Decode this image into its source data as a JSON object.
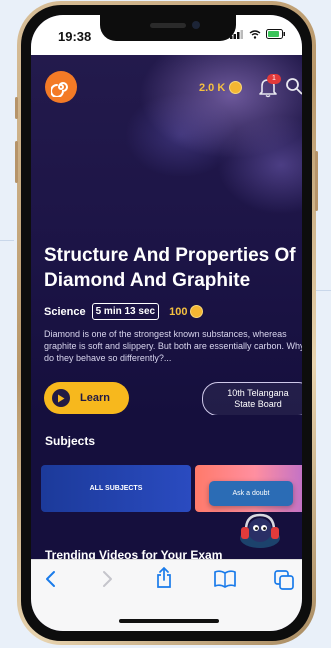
{
  "status": {
    "time": "19:38"
  },
  "header": {
    "coins": "2.0 K",
    "notification_count": "1"
  },
  "video": {
    "title": "Structure And Properties Of Diamond And Graphite",
    "subject": "Science",
    "duration": "5 min 13 sec",
    "points": "100",
    "description": "Diamond is one of the strongest known substances, whereas graphite is soft and slippery. But both are essentially carbon. Why do they behave so differently?..."
  },
  "actions": {
    "learn_label": "Learn",
    "board_label": "10th Telangana State Board"
  },
  "subjects": {
    "title": "Subjects",
    "all_subjects": "ALL SUBJECTS",
    "ask_doubt": "Ask a doubt"
  },
  "trending": {
    "title": "Trending Videos for Your Exam"
  },
  "colors": {
    "accent": "#f7b81d",
    "background": "#150f3d",
    "logo": "#f37a26",
    "ios_blue": "#1a7bea"
  },
  "icons": {
    "logo": "spiral-logo-icon",
    "coin": "coin-icon",
    "bell": "bell-icon",
    "search": "search-icon",
    "play": "play-icon",
    "back": "back-arrow-icon",
    "forward": "forward-arrow-icon",
    "share": "share-icon",
    "bookmarks": "book-icon",
    "tabs": "tabs-icon"
  }
}
